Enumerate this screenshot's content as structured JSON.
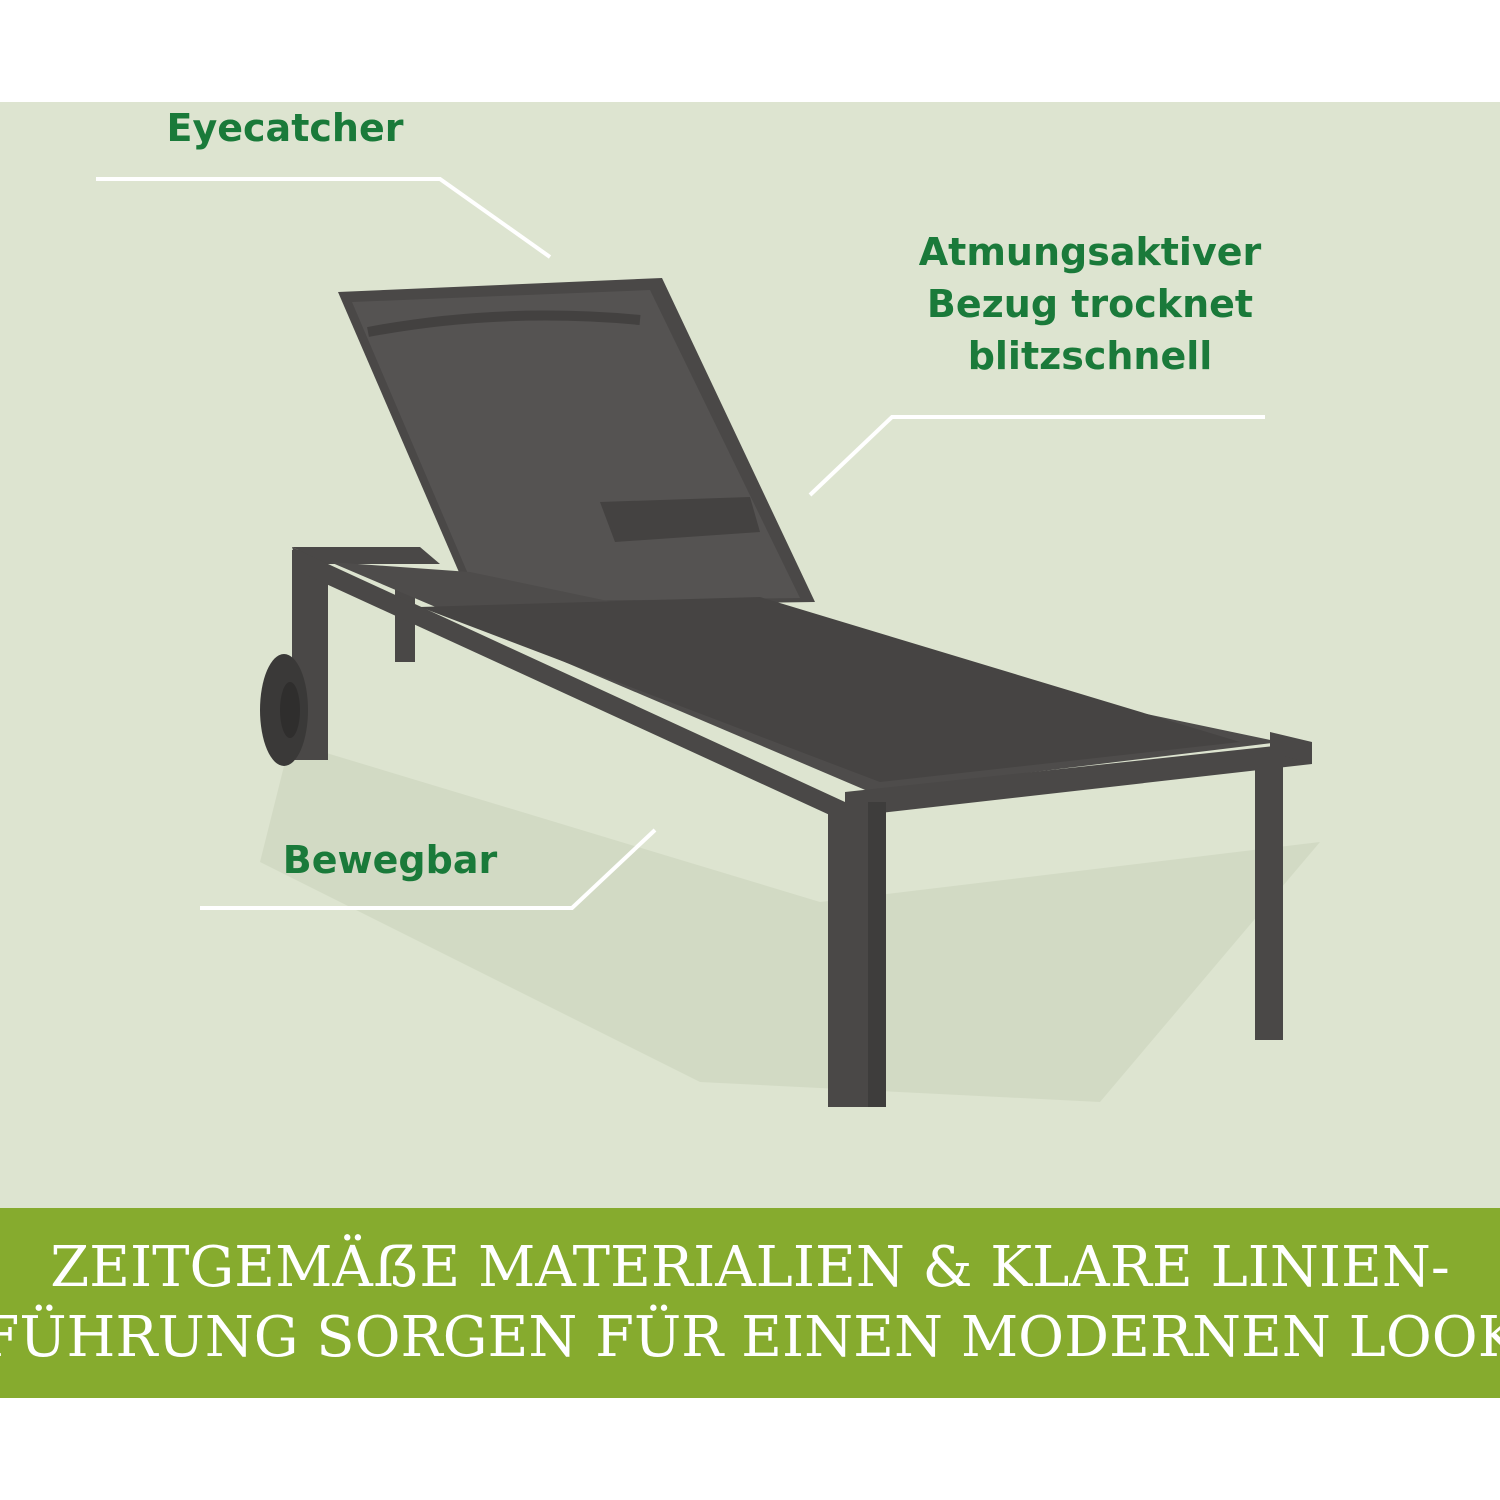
{
  "colors": {
    "stage_background": "#dde4d0",
    "callout_text": "#1a7a3a",
    "callout_line": "#ffffff",
    "lounger": "#4a4847",
    "lounger_dark": "#3a3938",
    "banner_background": "#86ab2e",
    "banner_text": "#ffffff"
  },
  "callouts": {
    "eyecatcher": "Eyecatcher",
    "fabric_lines": [
      "Atmungsaktiver",
      "Bezug trocknet",
      "blitzschnell"
    ],
    "mobile": "Bewegbar"
  },
  "banner": {
    "lines": [
      "ZEITGEMÄẞE MATERIALIEN & KLARE LINIEN-",
      "FÜHRUNG SORGEN FÜR EINEN MODERNEN LOOK"
    ]
  }
}
